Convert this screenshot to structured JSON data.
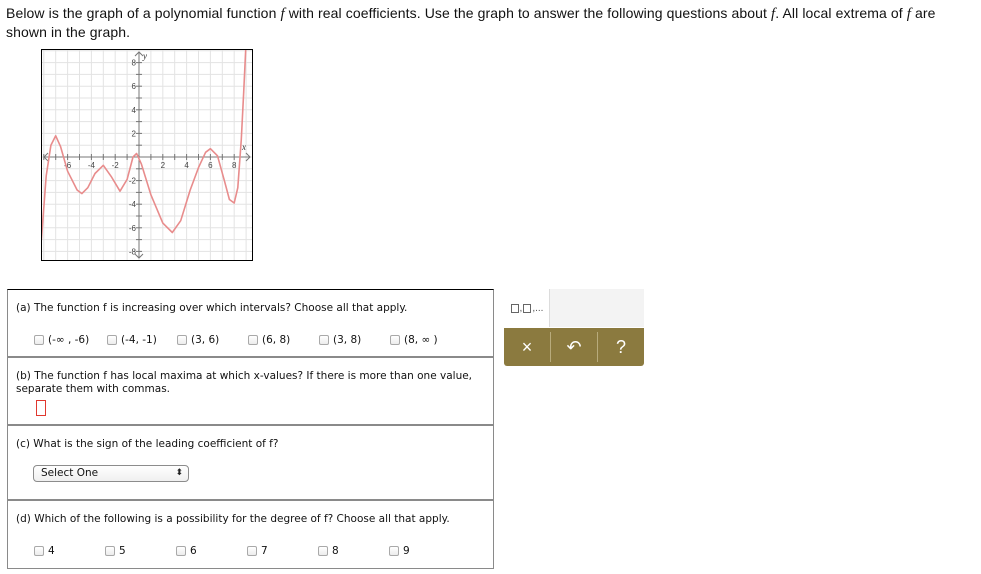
{
  "question": {
    "seg1": "Below is the graph of a polynomial function ",
    "fvar1": "f",
    "seg2": " with real coefficients. Use the graph to answer the following questions about ",
    "fvar2": "f",
    "seg3": ". All local extrema of ",
    "fvar3": "f",
    "seg4": " are shown in the graph."
  },
  "graph": {
    "x_axis_label": "x",
    "y_axis_label": "y",
    "x_ticks": [
      "-6",
      "-4",
      "-2",
      "2",
      "4",
      "6",
      "8"
    ],
    "y_ticks": [
      "8",
      "6",
      "4",
      "2",
      "-2",
      "-4",
      "-6",
      "-8"
    ],
    "curve_color": "#e88c8c",
    "grid_color": "#e3e3e3",
    "curve_points": [
      [
        -8.2,
        -7.0
      ],
      [
        -7.8,
        -1.6
      ],
      [
        -7.4,
        1.0
      ],
      [
        -7.0,
        1.8
      ],
      [
        -6.6,
        0.9
      ],
      [
        -6.0,
        -1.2
      ],
      [
        -5.2,
        -2.8
      ],
      [
        -4.8,
        -3.1
      ],
      [
        -4.3,
        -2.6
      ],
      [
        -3.7,
        -1.4
      ],
      [
        -3.0,
        -0.7
      ],
      [
        -2.3,
        -1.7
      ],
      [
        -1.6,
        -2.9
      ],
      [
        -1.0,
        -1.9
      ],
      [
        -0.5,
        0.0
      ],
      [
        -0.2,
        0.3
      ],
      [
        0.2,
        -0.6
      ],
      [
        1.0,
        -3.2
      ],
      [
        2.0,
        -5.6
      ],
      [
        2.8,
        -6.4
      ],
      [
        3.5,
        -5.4
      ],
      [
        4.3,
        -2.8
      ],
      [
        5.0,
        -0.9
      ],
      [
        5.6,
        0.4
      ],
      [
        6.0,
        0.7
      ],
      [
        6.6,
        0.1
      ],
      [
        7.2,
        -2.1
      ],
      [
        7.6,
        -3.6
      ],
      [
        8.0,
        -3.9
      ],
      [
        8.3,
        -2.6
      ],
      [
        8.6,
        1.5
      ],
      [
        8.8,
        5.5
      ],
      [
        9.0,
        9.8
      ]
    ]
  },
  "part_a": {
    "prompt": "(a) The function f is increasing over which intervals? Choose all that apply.",
    "options": [
      "(-∞ , -6)",
      "(-4, -1)",
      "(3, 6)",
      "(6, 8)",
      "(3, 8)",
      "(8, ∞ )"
    ]
  },
  "part_b": {
    "prompt": "(b) The function f has local maxima at which x-values? If there is more than one value, separate them with commas."
  },
  "part_c": {
    "prompt": "(c) What is the sign of the leading coefficient of f?",
    "select_value": "Select One",
    "select_arrow": "⬍"
  },
  "part_d": {
    "prompt": "(d) Which of the following is a possibility for the degree of f? Choose all that apply.",
    "options": [
      "4",
      "5",
      "6",
      "7",
      "8",
      "9"
    ]
  },
  "toolbox": {
    "format_ellipsis": "...",
    "format_comma1": ",",
    "format_comma2": ",",
    "clear_icon": "×",
    "undo_icon": "↶",
    "help_icon": "?",
    "accent_color": "#8b7a3f"
  }
}
